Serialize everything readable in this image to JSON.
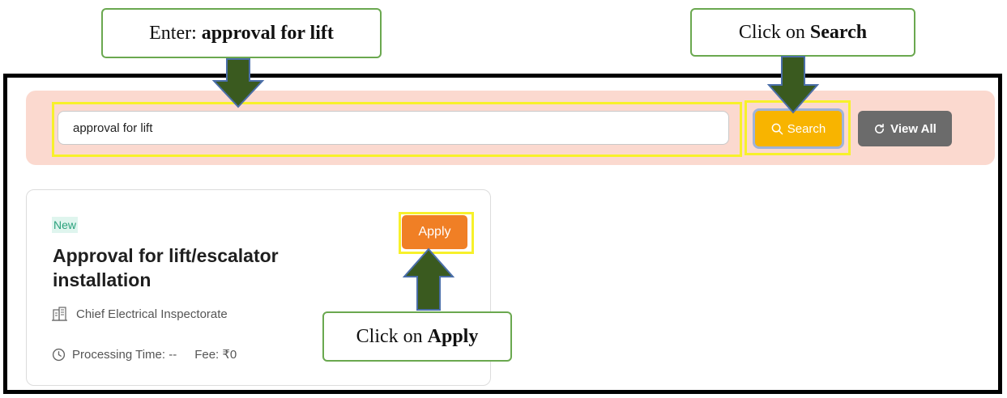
{
  "callouts": {
    "enter_prefix": "Enter: ",
    "enter_bold": "approval for lift",
    "search_prefix": "Click on ",
    "search_bold": "Search",
    "apply_prefix": "Click on ",
    "apply_bold": "Apply"
  },
  "search": {
    "value": "approval for lift",
    "search_label": "Search",
    "view_all_label": "View All"
  },
  "service_card": {
    "badge": "New",
    "apply_label": "Apply",
    "title": "Approval for lift/escalator installation",
    "department": "Chief Electrical Inspectorate",
    "processing_time": "Processing Time: --",
    "fee": "Fee: ₹0"
  },
  "colors": {
    "callout_border": "#6aa84f",
    "arrow_fill": "#3a5a1f",
    "arrow_stroke": "#4a6ea8",
    "highlight": "#f7f12a",
    "search_button": "#f8b400",
    "apply_button": "#f07f25",
    "search_band": "#fbd9cf"
  }
}
